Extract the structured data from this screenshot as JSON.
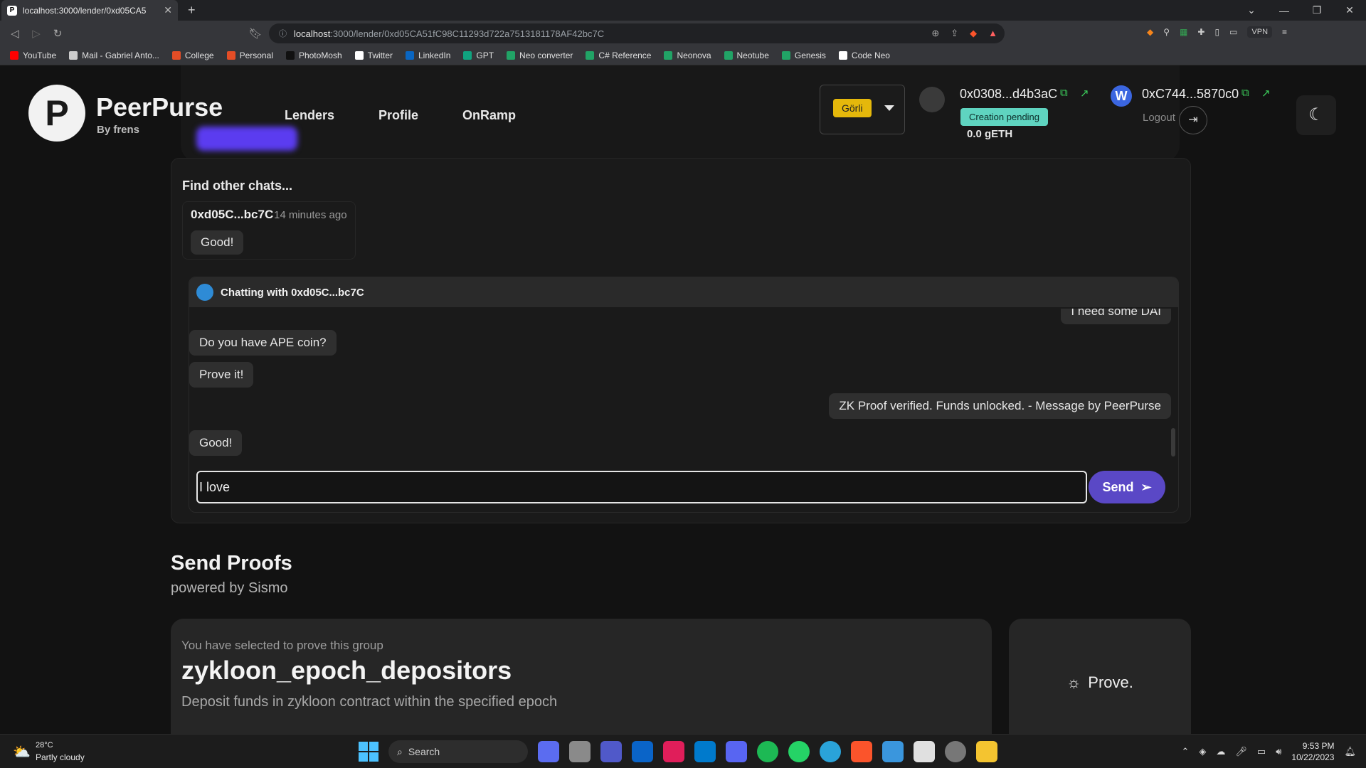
{
  "browser": {
    "tab_title": "localhost:3000/lender/0xd05CA5",
    "url_host": "localhost",
    "url_path": ":3000/lender/0xd05CA51fC98C11293d722a7513181178AF42bc7C",
    "vpn_label": "VPN",
    "bookmarks": [
      {
        "label": "YouTube",
        "color": "#ff0000"
      },
      {
        "label": "Mail - Gabriel Anto...",
        "color": "#cccccc"
      },
      {
        "label": "College",
        "color": "#e44d26"
      },
      {
        "label": "Personal",
        "color": "#e44d26"
      },
      {
        "label": "PhotoMosh",
        "color": "#111111"
      },
      {
        "label": "Twitter",
        "color": "#ffffff"
      },
      {
        "label": "LinkedIn",
        "color": "#0a66c2"
      },
      {
        "label": "GPT",
        "color": "#10a37f"
      },
      {
        "label": "Neo converter",
        "color": "#21a366"
      },
      {
        "label": "C# Reference",
        "color": "#21a366"
      },
      {
        "label": "Neonova",
        "color": "#21a366"
      },
      {
        "label": "Neotube",
        "color": "#21a366"
      },
      {
        "label": "Genesis",
        "color": "#21a366"
      },
      {
        "label": "Code Neo",
        "color": "#ffffff"
      }
    ]
  },
  "header": {
    "brand": "PeerPurse",
    "brand_sub": "By frens",
    "logo_letter": "P",
    "nav": [
      "Lenders",
      "Profile",
      "OnRamp"
    ],
    "network": "Görli",
    "wallet1_address": "0x0308...d4b3aC",
    "wallet1_status": "Creation pending",
    "wallet1_balance": "0.0 gETH",
    "wallet2_letter": "W",
    "wallet2_address": "0xC744...5870c0",
    "logout": "Logout"
  },
  "chat": {
    "find_title": "Find other chats...",
    "item": {
      "who": "0xd05C...bc7C",
      "when": "14 minutes ago",
      "last": "Good!"
    },
    "thread_title": "Chatting with 0xd05C...bc7C",
    "messages": [
      {
        "text": "I need some DAI",
        "side": "me"
      },
      {
        "text": "Do you have APE coin?",
        "side": "them"
      },
      {
        "text": "Prove it!",
        "side": "them"
      },
      {
        "text": "ZK Proof verified. Funds unlocked. - Message by PeerPurse",
        "side": "me"
      },
      {
        "text": "Good!",
        "side": "them"
      }
    ],
    "input_value": "I love",
    "send_label": "Send"
  },
  "proofs": {
    "title": "Send Proofs",
    "subtitle": "powered by Sismo",
    "selected_label": "You have selected to prove this group",
    "group_name": "zykloon_epoch_depositors",
    "group_desc": "Deposit funds in zykloon contract within the specified epoch",
    "prove_label": "Prove."
  },
  "taskbar": {
    "temp": "28°C",
    "weather": "Partly cloudy",
    "search": "Search",
    "time": "9:53 PM",
    "date": "10/22/2023"
  },
  "colors": {
    "accent": "#5a48c6",
    "network_chip": "#e5b80b",
    "pending_badge": "#5fd4c0",
    "copy_icon": "#3ccf5c"
  }
}
